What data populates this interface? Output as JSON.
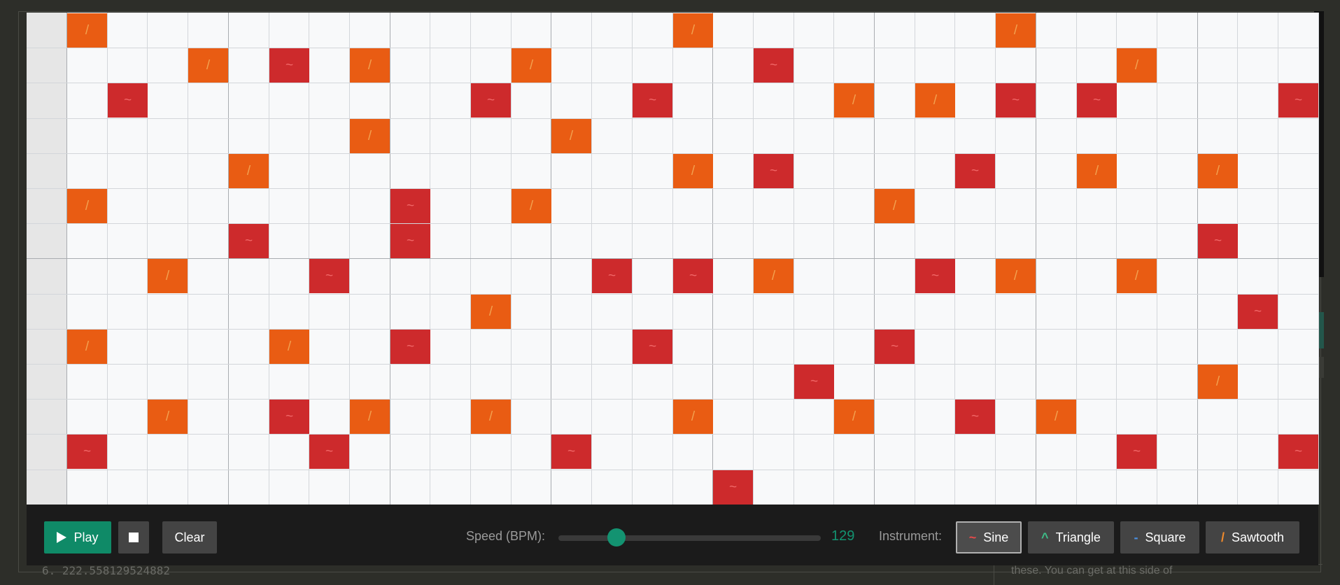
{
  "background": {
    "partial_left_text": "6. 222.558129524882",
    "partial_right_text": "these. You can get at this side of"
  },
  "sequencer": {
    "rows": 14,
    "cols": 31,
    "notes": [
      {
        "row": 0,
        "col": 1,
        "type": "saw"
      },
      {
        "row": 0,
        "col": 16,
        "type": "saw"
      },
      {
        "row": 0,
        "col": 24,
        "type": "saw"
      },
      {
        "row": 1,
        "col": 4,
        "type": "saw"
      },
      {
        "row": 1,
        "col": 6,
        "type": "sine"
      },
      {
        "row": 1,
        "col": 8,
        "type": "saw"
      },
      {
        "row": 1,
        "col": 12,
        "type": "saw"
      },
      {
        "row": 1,
        "col": 18,
        "type": "sine"
      },
      {
        "row": 1,
        "col": 27,
        "type": "saw"
      },
      {
        "row": 2,
        "col": 2,
        "type": "sine"
      },
      {
        "row": 2,
        "col": 11,
        "type": "sine"
      },
      {
        "row": 2,
        "col": 15,
        "type": "sine"
      },
      {
        "row": 2,
        "col": 20,
        "type": "saw"
      },
      {
        "row": 2,
        "col": 22,
        "type": "saw"
      },
      {
        "row": 2,
        "col": 24,
        "type": "sine"
      },
      {
        "row": 2,
        "col": 26,
        "type": "sine"
      },
      {
        "row": 2,
        "col": 31,
        "type": "sine"
      },
      {
        "row": 3,
        "col": 8,
        "type": "saw"
      },
      {
        "row": 3,
        "col": 13,
        "type": "saw"
      },
      {
        "row": 4,
        "col": 5,
        "type": "saw"
      },
      {
        "row": 4,
        "col": 16,
        "type": "saw"
      },
      {
        "row": 4,
        "col": 18,
        "type": "sine"
      },
      {
        "row": 4,
        "col": 23,
        "type": "sine"
      },
      {
        "row": 4,
        "col": 26,
        "type": "saw"
      },
      {
        "row": 4,
        "col": 29,
        "type": "saw"
      },
      {
        "row": 5,
        "col": 1,
        "type": "saw"
      },
      {
        "row": 5,
        "col": 9,
        "type": "sine"
      },
      {
        "row": 5,
        "col": 12,
        "type": "saw"
      },
      {
        "row": 5,
        "col": 21,
        "type": "saw"
      },
      {
        "row": 6,
        "col": 5,
        "type": "sine"
      },
      {
        "row": 6,
        "col": 9,
        "type": "sine"
      },
      {
        "row": 6,
        "col": 29,
        "type": "sine"
      },
      {
        "row": 7,
        "col": 3,
        "type": "saw"
      },
      {
        "row": 7,
        "col": 7,
        "type": "sine"
      },
      {
        "row": 7,
        "col": 14,
        "type": "sine"
      },
      {
        "row": 7,
        "col": 16,
        "type": "sine"
      },
      {
        "row": 7,
        "col": 18,
        "type": "saw"
      },
      {
        "row": 7,
        "col": 22,
        "type": "sine"
      },
      {
        "row": 7,
        "col": 24,
        "type": "saw"
      },
      {
        "row": 7,
        "col": 27,
        "type": "saw"
      },
      {
        "row": 8,
        "col": 11,
        "type": "saw"
      },
      {
        "row": 8,
        "col": 30,
        "type": "sine"
      },
      {
        "row": 9,
        "col": 1,
        "type": "saw"
      },
      {
        "row": 9,
        "col": 6,
        "type": "saw"
      },
      {
        "row": 9,
        "col": 9,
        "type": "sine"
      },
      {
        "row": 9,
        "col": 15,
        "type": "sine"
      },
      {
        "row": 9,
        "col": 21,
        "type": "sine"
      },
      {
        "row": 10,
        "col": 19,
        "type": "sine"
      },
      {
        "row": 10,
        "col": 29,
        "type": "saw"
      },
      {
        "row": 11,
        "col": 3,
        "type": "saw"
      },
      {
        "row": 11,
        "col": 6,
        "type": "sine"
      },
      {
        "row": 11,
        "col": 8,
        "type": "saw"
      },
      {
        "row": 11,
        "col": 11,
        "type": "saw"
      },
      {
        "row": 11,
        "col": 16,
        "type": "saw"
      },
      {
        "row": 11,
        "col": 20,
        "type": "saw"
      },
      {
        "row": 11,
        "col": 23,
        "type": "sine"
      },
      {
        "row": 11,
        "col": 25,
        "type": "saw"
      },
      {
        "row": 12,
        "col": 1,
        "type": "sine"
      },
      {
        "row": 12,
        "col": 7,
        "type": "sine"
      },
      {
        "row": 12,
        "col": 13,
        "type": "sine"
      },
      {
        "row": 12,
        "col": 27,
        "type": "sine"
      },
      {
        "row": 12,
        "col": 31,
        "type": "sine"
      },
      {
        "row": 13,
        "col": 17,
        "type": "sine"
      }
    ],
    "symbols": {
      "sine": "~",
      "saw": "/"
    },
    "colors": {
      "sine": "#cd2a2c",
      "saw": "#e95c13"
    }
  },
  "controls": {
    "play_label": "Play",
    "clear_label": "Clear",
    "speed_label": "Speed (BPM):",
    "bpm_value": "129",
    "bpm_fraction": 0.2,
    "instrument_label": "Instrument:",
    "instruments": [
      {
        "symbol": "~",
        "label": "Sine",
        "symbol_color": "#e84a4a",
        "active": true
      },
      {
        "symbol": "^",
        "label": "Triangle",
        "symbol_color": "#3ec08a",
        "active": false
      },
      {
        "symbol": "-",
        "label": "Square",
        "symbol_color": "#4a90e2",
        "active": false
      },
      {
        "symbol": "/",
        "label": "Sawtooth",
        "symbol_color": "#f08a2c",
        "active": false
      }
    ],
    "accent_color": "#139371"
  }
}
